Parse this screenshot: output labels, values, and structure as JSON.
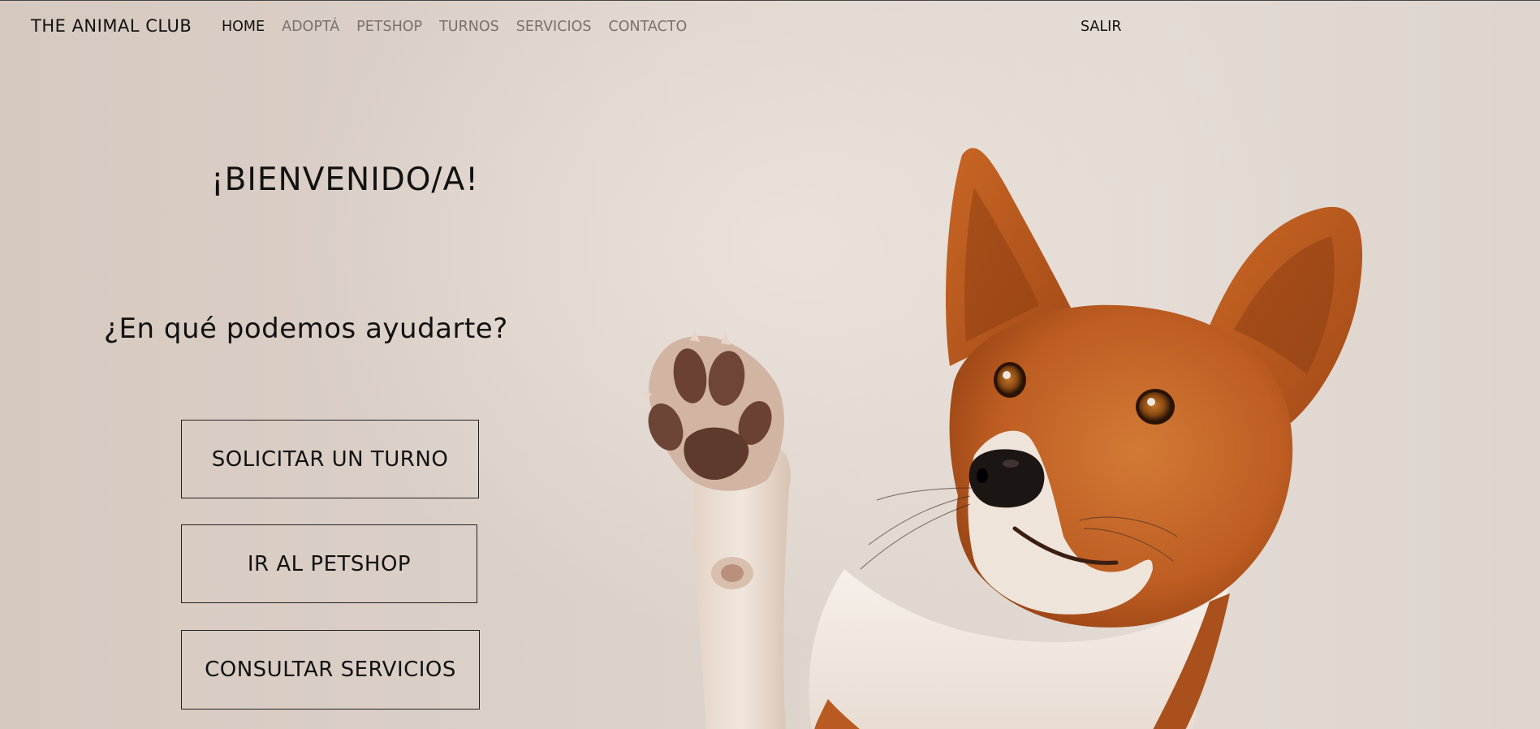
{
  "navbar": {
    "brand": "THE ANIMAL CLUB",
    "links": [
      {
        "label": "HOME",
        "active": true
      },
      {
        "label": "ADOPTÁ",
        "active": false
      },
      {
        "label": "PETSHOP",
        "active": false
      },
      {
        "label": "TURNOS",
        "active": false
      },
      {
        "label": "SERVICIOS",
        "active": false
      },
      {
        "label": "CONTACTO",
        "active": false
      }
    ],
    "logout_label": "SALIR"
  },
  "hero": {
    "title": "¡BIENVENIDO/A!",
    "subtitle": "¿En qué podemos ayudarte?",
    "buttons": {
      "turno": "SOLICITAR UN TURNO",
      "petshop": "IR AL PETSHOP",
      "servicios": "CONSULTAR SERVICIOS"
    },
    "image": "dog-waving-paw"
  },
  "colors": {
    "background": "#d8ccc2",
    "text": "#111111",
    "nav_inactive": "#7a716c",
    "dog_fur": "#c4692a",
    "dog_white": "#f3ece6"
  }
}
